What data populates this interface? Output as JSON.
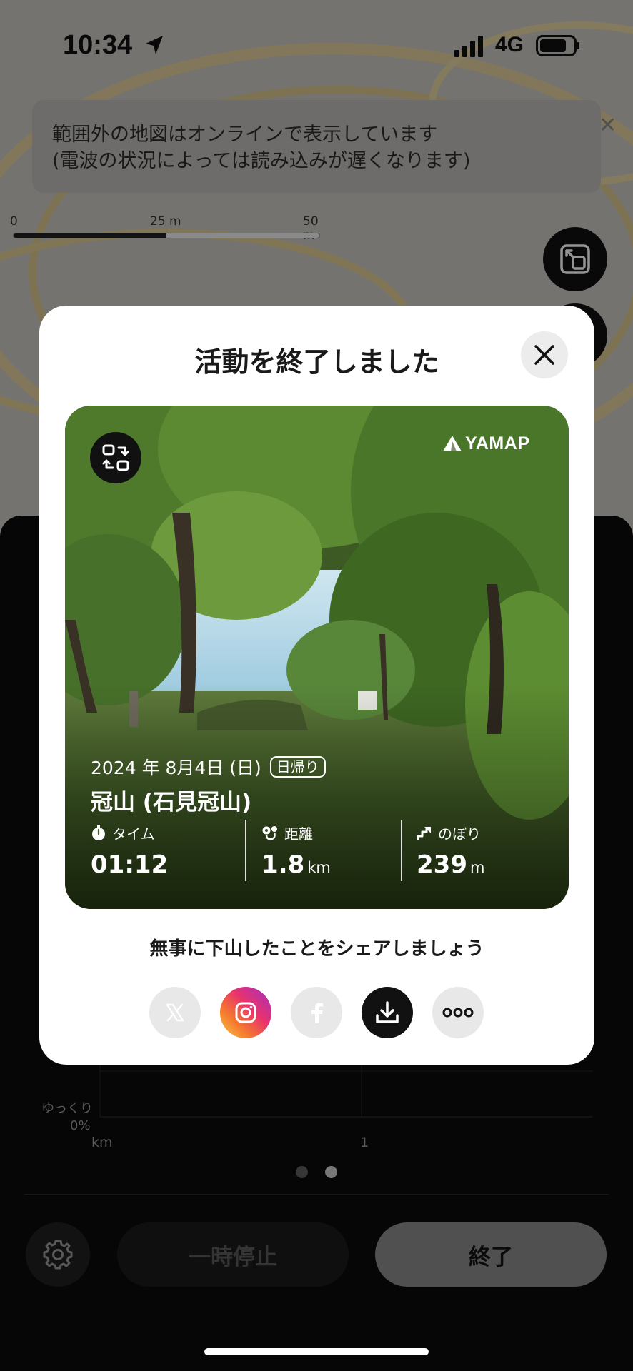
{
  "status_bar": {
    "time": "10:34",
    "network": "4G",
    "icons": [
      "location-arrow-icon",
      "signal-bars-icon",
      "battery-icon"
    ]
  },
  "map": {
    "offline_notice_line1": "範囲外の地図はオンラインで表示しています",
    "offline_notice_line2": "(電波の状況によっては読み込みが遅くなります)",
    "scale": {
      "label_0": "0",
      "label_mid": "25 m",
      "label_max": "50 m"
    },
    "colors": {
      "contour": "#e0ce9c",
      "base": "#c9c6c0"
    }
  },
  "panel": {
    "pace_slow_label": "ゆっくり",
    "pace_zero_label": "0%",
    "x_unit": "km",
    "x_tick": "1",
    "pause_label": "一時停止",
    "finish_label": "終了",
    "page_count": 2,
    "active_page": 2
  },
  "modal": {
    "title": "活動を終了しました",
    "share_prompt": "無事に下山したことをシェアしましょう",
    "share_targets": [
      "x-icon",
      "instagram-icon",
      "facebook-icon",
      "download-icon",
      "more-icon"
    ],
    "card": {
      "brand": "YAMAP",
      "date": "2024 年 8月4日 (日)",
      "trip_type": "日帰り",
      "mountain": "冠山 (石見冠山)",
      "stats": {
        "time_label": "タイム",
        "time_value": "01:12",
        "distance_label": "距離",
        "distance_value": "1.8",
        "distance_unit": "km",
        "climb_label": "のぼり",
        "climb_value": "239",
        "climb_unit": "m"
      }
    }
  },
  "colors": {
    "accent_dark": "#111111",
    "panel_bg": "#0b0b0b",
    "modal_bg": "#ffffff"
  }
}
